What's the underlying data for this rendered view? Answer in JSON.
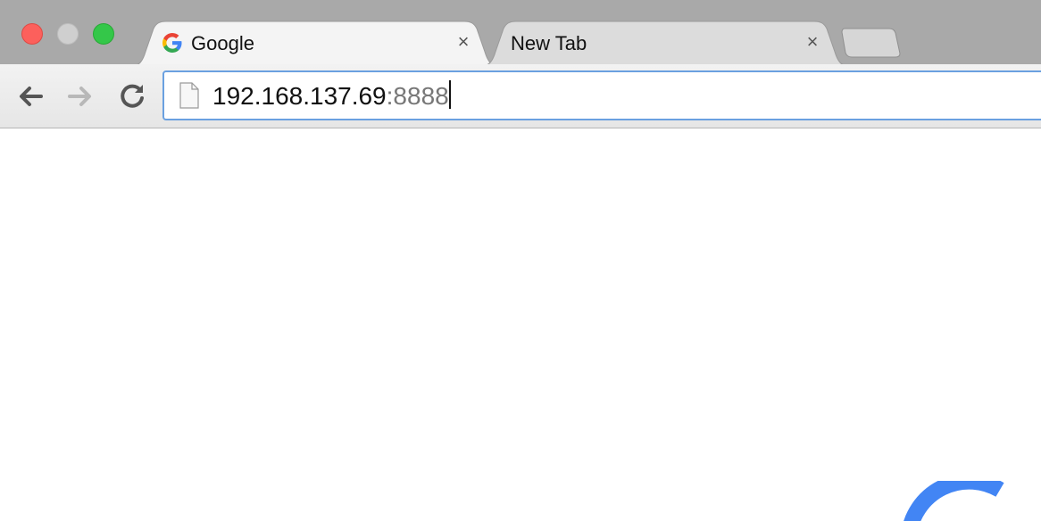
{
  "window": {
    "controls": {
      "close": "close-button",
      "minimize": "minimize-button",
      "maximize": "maximize-button"
    }
  },
  "tabs": [
    {
      "label": "Google",
      "favicon": "google-g-icon",
      "close": "×",
      "active": true
    },
    {
      "label": "New Tab",
      "favicon": null,
      "close": "×",
      "active": false
    }
  ],
  "toolbar": {
    "back_icon": "arrow-left-icon",
    "forward_icon": "arrow-right-icon",
    "reload_icon": "reload-icon"
  },
  "omnibox": {
    "host": "192.168.137.69",
    "port": ":8888",
    "page_icon": "page-icon"
  },
  "colors": {
    "tabstrip": "#a9a9a9",
    "omnibox_border": "#6aa0e0",
    "spinner": "#4285f4"
  },
  "content": {
    "loading_icon": "loading-spinner-icon"
  }
}
